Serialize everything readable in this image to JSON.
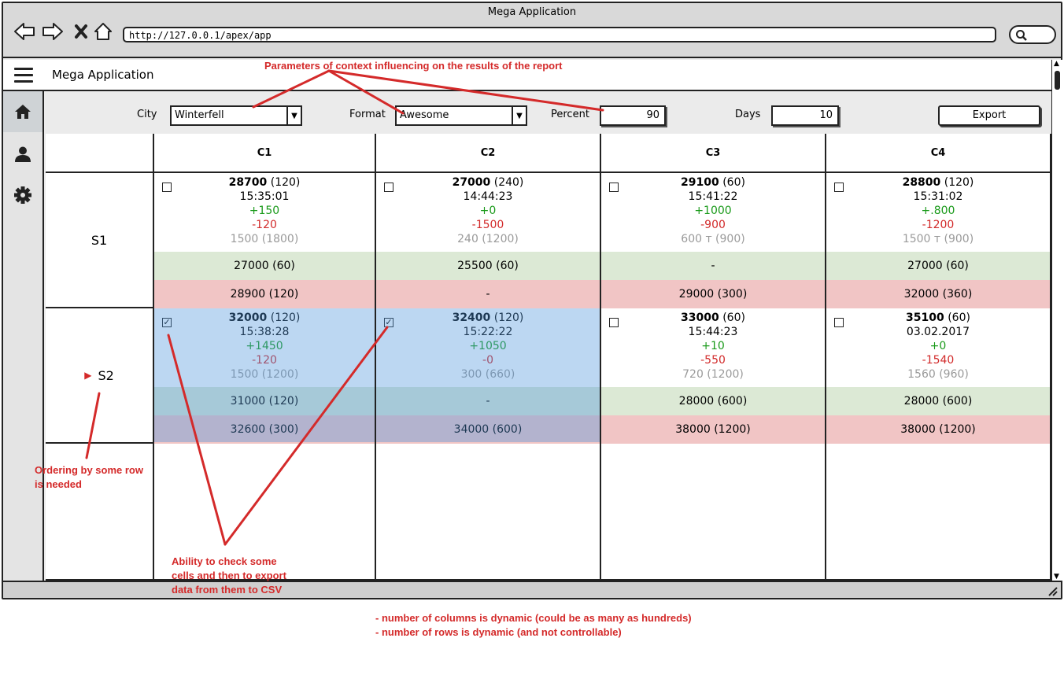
{
  "browser": {
    "window_title": "Mega Application",
    "url": "http://127.0.0.1/apex/app"
  },
  "app": {
    "title": "Mega Application"
  },
  "sidebar": {
    "items": [
      "home-icon",
      "user-icon",
      "gear-icon"
    ]
  },
  "filters": {
    "city_label": "City",
    "city_value": "Winterfell",
    "format_label": "Format",
    "format_value": "Awesome",
    "percent_label": "Percent",
    "percent_value": "90",
    "days_label": "Days",
    "days_value": "10",
    "export_label": "Export"
  },
  "table": {
    "columns": [
      "C1",
      "C2",
      "C3",
      "C4"
    ],
    "rows": [
      {
        "label": "S1",
        "cells": [
          {
            "value": "28700",
            "count": "(120)",
            "time": "15:35:01",
            "plus": "+150",
            "minus": "-120",
            "extra": "1500 (1800)",
            "band_green": "27000 (60)",
            "band_red": "28900 (120)",
            "checked": false
          },
          {
            "value": "27000",
            "count": "(240)",
            "time": "14:44:23",
            "plus": "+0",
            "minus": "-1500",
            "extra": "240 (1200)",
            "band_green": "25500 (60)",
            "band_red": "-",
            "checked": false
          },
          {
            "value": "29100",
            "count": "(60)",
            "time": "15:41:22",
            "plus": "+1000",
            "minus": "-900",
            "extra": "600 т (900)",
            "band_green": "-",
            "band_red": "29000 (300)",
            "checked": false
          },
          {
            "value": "28800",
            "count": "(120)",
            "time": "15:31:02",
            "plus": "+.800",
            "minus": "-1200",
            "extra": "1500 т (900)",
            "band_green": "27000 (60)",
            "band_red": "32000 (360)",
            "checked": false
          }
        ]
      },
      {
        "label": "S2",
        "cells": [
          {
            "value": "32000",
            "count": "(120)",
            "time": "15:38:28",
            "plus": "+1450",
            "minus": "-120",
            "extra": "1500 (1200)",
            "band_green": "31000 (120)",
            "band_red": "32600 (300)",
            "checked": true
          },
          {
            "value": "32400",
            "count": "(120)",
            "time": "15:22:22",
            "plus": "+1050",
            "minus": "-0",
            "extra": "300 (660)",
            "band_green": "-",
            "band_red": "34000 (600)",
            "checked": true
          },
          {
            "value": "33000",
            "count": "(60)",
            "time": "15:44:23",
            "plus": "+10",
            "minus": "-550",
            "extra": "720 (1200)",
            "band_green": "28000 (600)",
            "band_red": "38000 (1200)",
            "checked": false
          },
          {
            "value": "35100",
            "count": "(60)",
            "time": "03.02.2017",
            "plus": "+0",
            "minus": "-1540",
            "extra": "1560 (960)",
            "band_green": "28000 (600)",
            "band_red": "38000 (1200)",
            "checked": false
          }
        ]
      }
    ]
  },
  "annotations": {
    "params": "Parameters of context influencing on the results of the report",
    "ordering": "Ordering by some row is needed",
    "checking": "Ability to check some cells and then to export data from them to CSV",
    "note1": "- number of columns is dynamic (could be as many as hundreds)",
    "note2": "- number of rows is dynamic (and not controllable)"
  },
  "colors": {
    "annotation": "#d42a2a",
    "selection": "#5096dc",
    "band_green": "#dce9d5",
    "band_red": "#f1c5c5"
  }
}
